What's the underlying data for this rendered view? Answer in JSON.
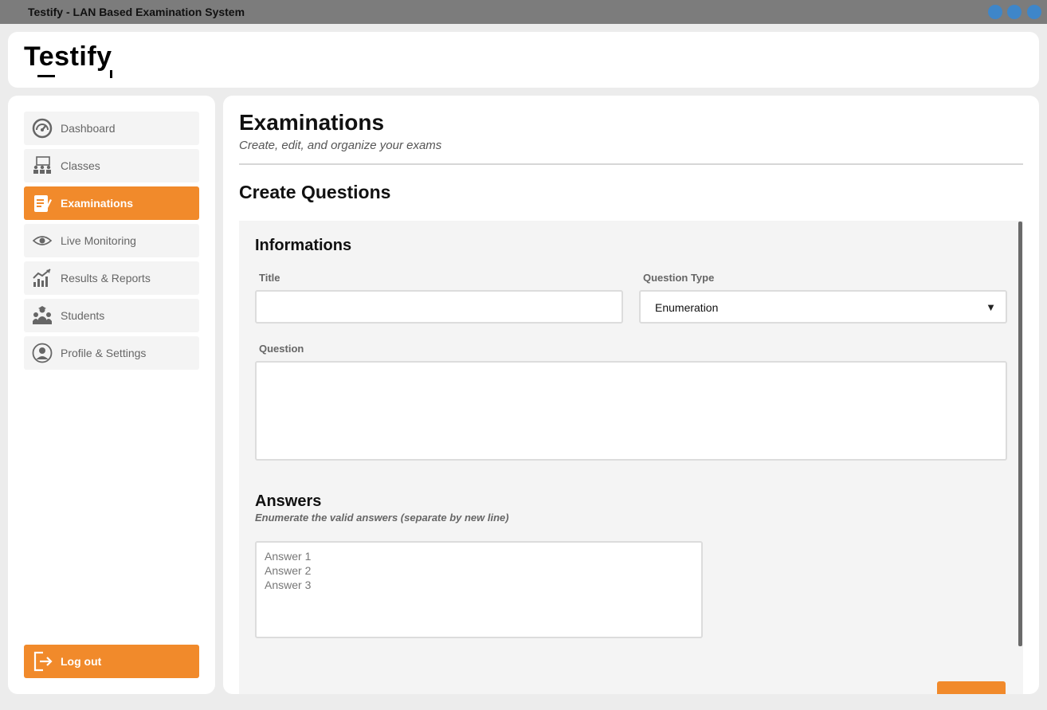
{
  "window": {
    "title": "Testify - LAN Based Examination System",
    "controls": [
      "minimize-button",
      "maximize-button",
      "close-button"
    ],
    "control_color": "#3e86c9"
  },
  "header": {
    "logo_text": "Testify"
  },
  "sidebar": {
    "items": [
      {
        "label": "Dashboard",
        "icon": "gauge-icon",
        "active": false
      },
      {
        "label": "Classes",
        "icon": "classroom-icon",
        "active": false
      },
      {
        "label": "Examinations",
        "icon": "exam-notepad-icon",
        "active": true
      },
      {
        "label": "Live Monitoring",
        "icon": "eye-icon",
        "active": false
      },
      {
        "label": "Results & Reports",
        "icon": "trend-chart-icon",
        "active": false
      },
      {
        "label": "Students",
        "icon": "students-group-icon",
        "active": false
      },
      {
        "label": "Profile & Settings",
        "icon": "user-circle-icon",
        "active": false
      }
    ],
    "logout_label": "Log out",
    "logout_icon": "logout-icon"
  },
  "main": {
    "title": "Examinations",
    "subtitle": "Create, edit, and organize your exams",
    "section_title": "Create Questions",
    "form": {
      "info_title": "Informations",
      "title_label": "Title",
      "title_value": "",
      "question_type_label": "Question Type",
      "question_type_value": "Enumeration",
      "question_label": "Question",
      "question_value": "",
      "answers_title": "Answers",
      "answers_subtitle": "Enumerate the valid answers (separate by new line)",
      "answers_placeholder": [
        "Answer 1",
        "Answer 2",
        "Answer 3"
      ]
    }
  },
  "colors": {
    "accent": "#f18a2b",
    "titlebar": "#7c7c7c",
    "panel": "#f4f4f4"
  }
}
